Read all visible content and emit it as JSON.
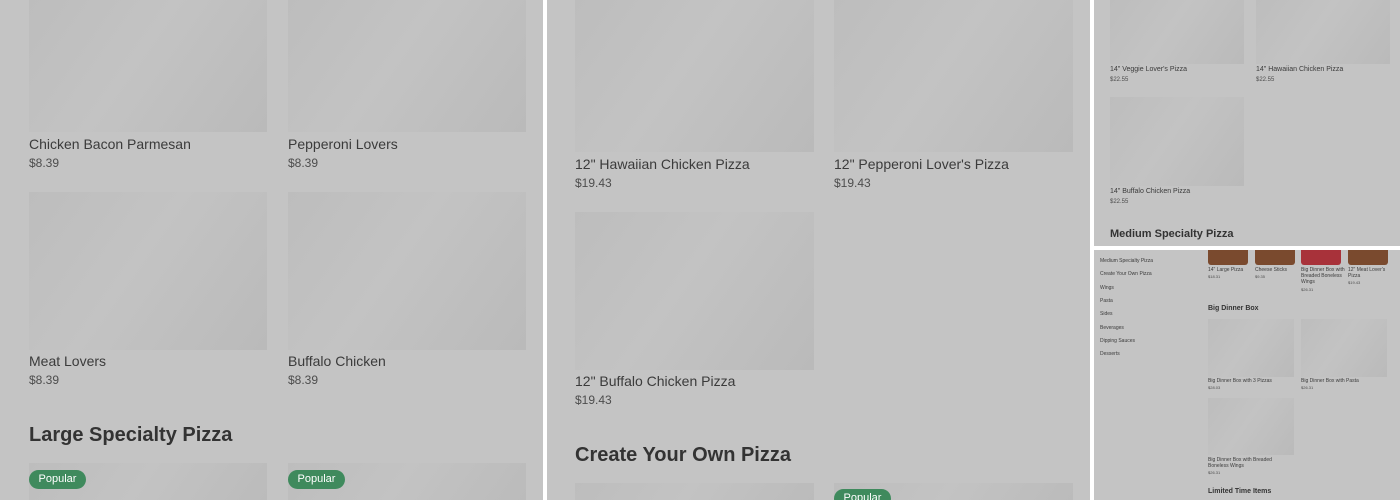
{
  "panel1": {
    "items": [
      {
        "name": "Chicken Bacon Parmesan",
        "price": "$8.39"
      },
      {
        "name": "Pepperoni Lovers",
        "price": "$8.39"
      },
      {
        "name": "Meat Lovers",
        "price": "$8.39"
      },
      {
        "name": "Buffalo Chicken",
        "price": "$8.39"
      }
    ],
    "heading": "Large Specialty Pizza",
    "badges": [
      "Popular",
      "Popular"
    ]
  },
  "panel2": {
    "items": [
      {
        "name": "12\" Hawaiian Chicken Pizza",
        "price": "$19.43"
      },
      {
        "name": "12\" Pepperoni Lover's Pizza",
        "price": "$19.43"
      },
      {
        "name": "12\" Buffalo Chicken Pizza",
        "price": "$19.43"
      }
    ],
    "heading": "Create Your Own Pizza",
    "badge": "Popular"
  },
  "panel3": {
    "items": [
      {
        "name": "14\" Veggie Lover's Pizza",
        "price": "$22.55"
      },
      {
        "name": "14\" Hawaiian Chicken Pizza",
        "price": "$22.55"
      },
      {
        "name": "14\" Buffalo Chicken Pizza",
        "price": "$22.55"
      }
    ],
    "heading": "Medium Specialty Pizza"
  },
  "panel4": {
    "sidebar": [
      "Medium Specialty Pizza",
      "Create Your Own Pizza",
      "Wings",
      "Pasta",
      "Sides",
      "Beverages",
      "Dipping Sauces",
      "Desserts"
    ],
    "top_items": [
      {
        "name": "14\" Large Pizza",
        "price": "$18.31"
      },
      {
        "name": "Cheese Sticks",
        "price": "$9.35"
      },
      {
        "name": "Big Dinner Box with Breaded Boneless Wings",
        "price": "$26.31"
      },
      {
        "name": "12\" Meat Lover's Pizza",
        "price": "$19.43"
      }
    ],
    "heading": "Big Dinner Box",
    "items": [
      {
        "name": "Big Dinner Box with 3 Pizzas",
        "price": "$28.03"
      },
      {
        "name": "Big Dinner Box with Pasta",
        "price": "$26.31"
      },
      {
        "name": "Big Dinner Box with Breaded Boneless Wings",
        "price": "$26.31"
      }
    ],
    "heading2": "Limited Time Items"
  }
}
